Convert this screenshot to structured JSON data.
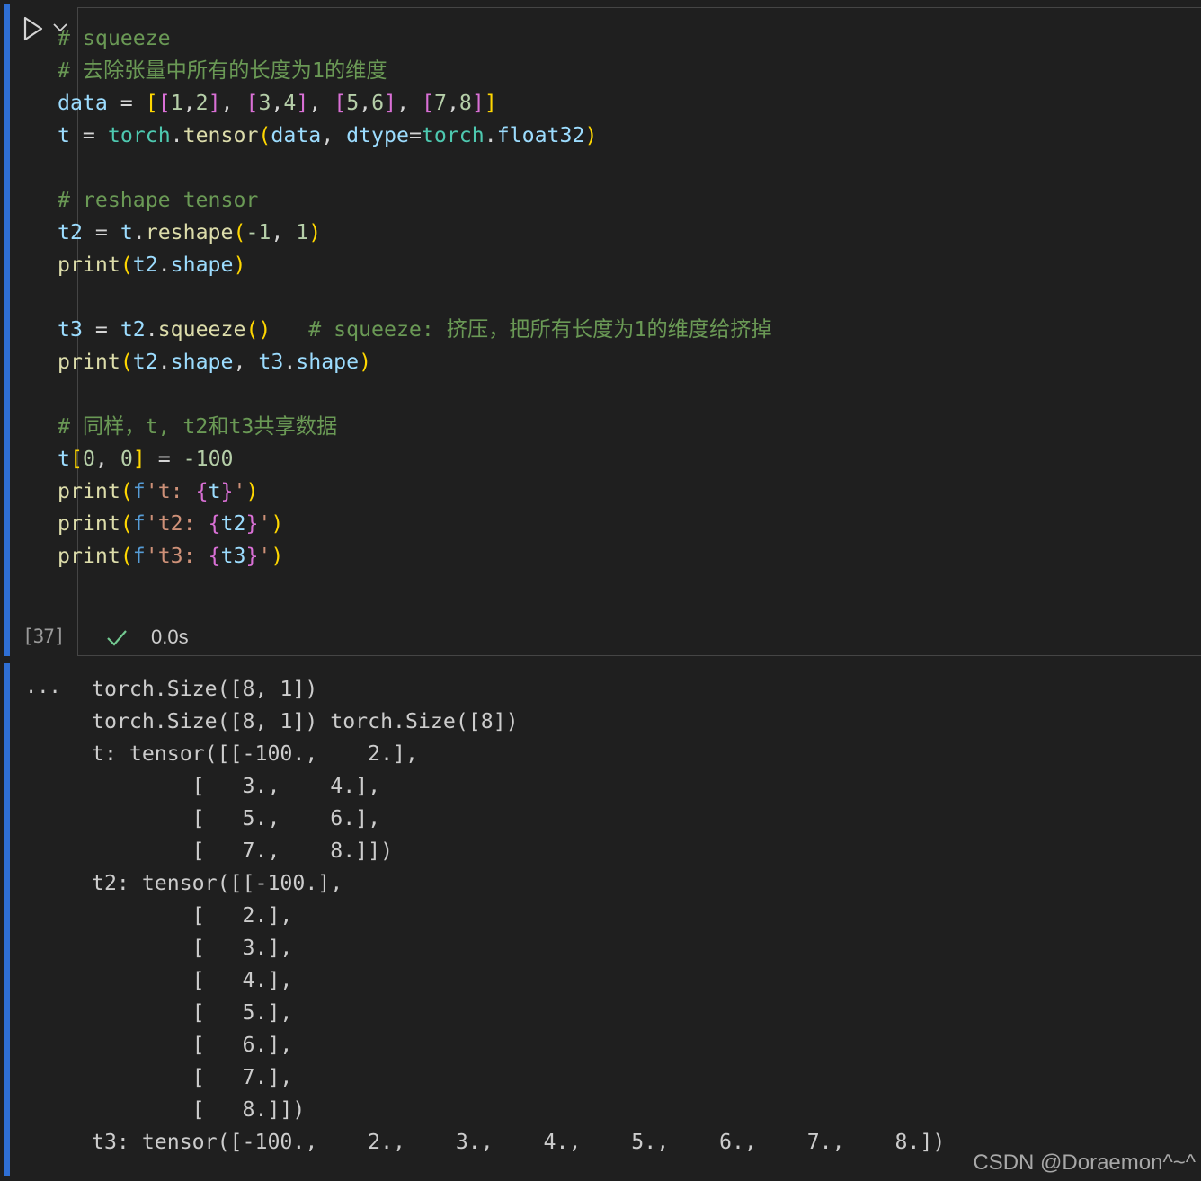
{
  "cell": {
    "execution_count": "[37]",
    "status_time": "0.0s",
    "status_icon": "check-icon",
    "run_icon": "play-icon",
    "menu_icon": "chevron-down-icon",
    "accent_color": "#2f6fd4"
  },
  "code": {
    "comment_squeeze": "# squeeze",
    "comment_desc": "# 去除张量中所有的长度为1的维度",
    "data_var": "data",
    "t_var": "t",
    "torch_mod": "torch",
    "tensor_fn": "tensor",
    "dtype_kw": "dtype",
    "float32": "float32",
    "comment_reshape": "# reshape tensor",
    "t2_var": "t2",
    "reshape_fn": "reshape",
    "print_fn": "print",
    "shape_attr": "shape",
    "t3_var": "t3",
    "squeeze_fn": "squeeze",
    "comment_squeeze_inline": "# squeeze: 挤压，把所有长度为1的维度给挤掉",
    "comment_share": "# 同样，t, t2和t3共享数据",
    "num_neg100": "-100",
    "num_0": "0",
    "num_1": "1",
    "num_neg1": "-1",
    "n1": "1",
    "n2": "2",
    "n3": "3",
    "n4": "4",
    "n5": "5",
    "n6": "6",
    "n7": "7",
    "n8": "8",
    "fstr_t": "'t: ",
    "fstr_t2": "'t2: ",
    "fstr_t3": "'t3: ",
    "fstr_close": "'",
    "f_prefix": "f"
  },
  "output": {
    "more_label": "...",
    "lines": [
      "torch.Size([8, 1])",
      "torch.Size([8, 1]) torch.Size([8])",
      "t: tensor([[-100.,    2.],",
      "        [   3.,    4.],",
      "        [   5.,    6.],",
      "        [   7.,    8.]])",
      "t2: tensor([[-100.],",
      "        [   2.],",
      "        [   3.],",
      "        [   4.],",
      "        [   5.],",
      "        [   6.],",
      "        [   7.],",
      "        [   8.]])",
      "t3: tensor([-100.,    2.,    3.,    4.,    5.,    6.,    7.,    8.])"
    ]
  },
  "watermark": "CSDN @Doraemon^~^"
}
